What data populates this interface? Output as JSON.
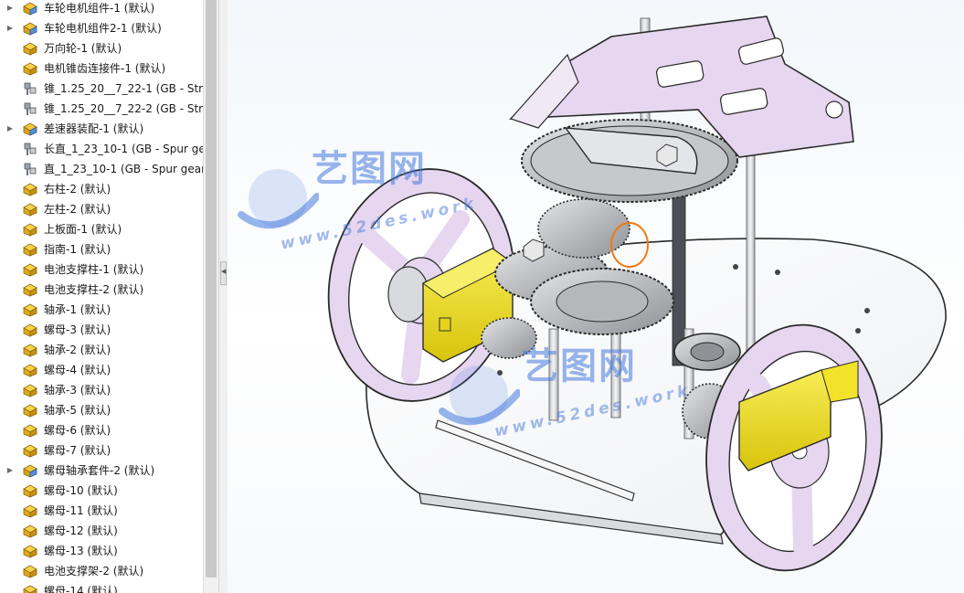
{
  "feature_tree": {
    "items": [
      {
        "label": "车轮电机组件-1 (默认)",
        "type": "assembly",
        "expandable": true
      },
      {
        "label": "车轮电机组件2-1 (默认)",
        "type": "assembly",
        "expandable": true
      },
      {
        "label": "万向轮-1 (默认)",
        "type": "part",
        "expandable": false
      },
      {
        "label": "电机锥齿连接件-1 (默认)",
        "type": "part",
        "expandable": false
      },
      {
        "label": "锥_1.25_20__7_22-1 (GB - Straig",
        "type": "toolbox",
        "expandable": false
      },
      {
        "label": "锥_1.25_20__7_22-2 (GB - Straig",
        "type": "toolbox",
        "expandable": false
      },
      {
        "label": "差速器装配-1 (默认)",
        "type": "assembly",
        "expandable": true
      },
      {
        "label": "长直_1_23_10-1 (GB - Spur gea",
        "type": "toolbox",
        "expandable": false
      },
      {
        "label": "直_1_23_10-1 (GB - Spur gear",
        "type": "toolbox",
        "expandable": false
      },
      {
        "label": "右柱-2 (默认)",
        "type": "part",
        "expandable": false
      },
      {
        "label": "左柱-2 (默认)",
        "type": "part",
        "expandable": false
      },
      {
        "label": "上板面-1 (默认)",
        "type": "part",
        "expandable": false
      },
      {
        "label": "指南-1 (默认)",
        "type": "part",
        "expandable": false
      },
      {
        "label": "电池支撑柱-1 (默认)",
        "type": "part",
        "expandable": false
      },
      {
        "label": "电池支撑柱-2 (默认)",
        "type": "part",
        "expandable": false
      },
      {
        "label": "轴承-1 (默认)",
        "type": "part",
        "expandable": false
      },
      {
        "label": "螺母-3 (默认)",
        "type": "part",
        "expandable": false
      },
      {
        "label": "轴承-2 (默认)",
        "type": "part",
        "expandable": false
      },
      {
        "label": "螺母-4 (默认)",
        "type": "part",
        "expandable": false
      },
      {
        "label": "轴承-3 (默认)",
        "type": "part",
        "expandable": false
      },
      {
        "label": "轴承-5 (默认)",
        "type": "part",
        "expandable": false
      },
      {
        "label": "螺母-6 (默认)",
        "type": "part",
        "expandable": false
      },
      {
        "label": "螺母-7 (默认)",
        "type": "part",
        "expandable": false
      },
      {
        "label": "螺母轴承套件-2 (默认)",
        "type": "assembly",
        "expandable": true
      },
      {
        "label": "螺母-10 (默认)",
        "type": "part",
        "expandable": false
      },
      {
        "label": "螺母-11 (默认)",
        "type": "part",
        "expandable": false
      },
      {
        "label": "螺母-12 (默认)",
        "type": "part",
        "expandable": false
      },
      {
        "label": "螺母-13 (默认)",
        "type": "part",
        "expandable": false
      },
      {
        "label": "电池支撑架-2 (默认)",
        "type": "part",
        "expandable": false
      },
      {
        "label": "螺母-14 (默认)",
        "type": "part",
        "expandable": false
      }
    ]
  },
  "watermark": {
    "name": "艺图网",
    "url": "www.52des.work"
  },
  "colors": {
    "wheel": "#e6d6ef",
    "motor": "#f2e229",
    "metal": "#d7d9dc",
    "gear": "#bdbfc2",
    "selection": "#f07a10",
    "watermark": "#4678dc"
  }
}
